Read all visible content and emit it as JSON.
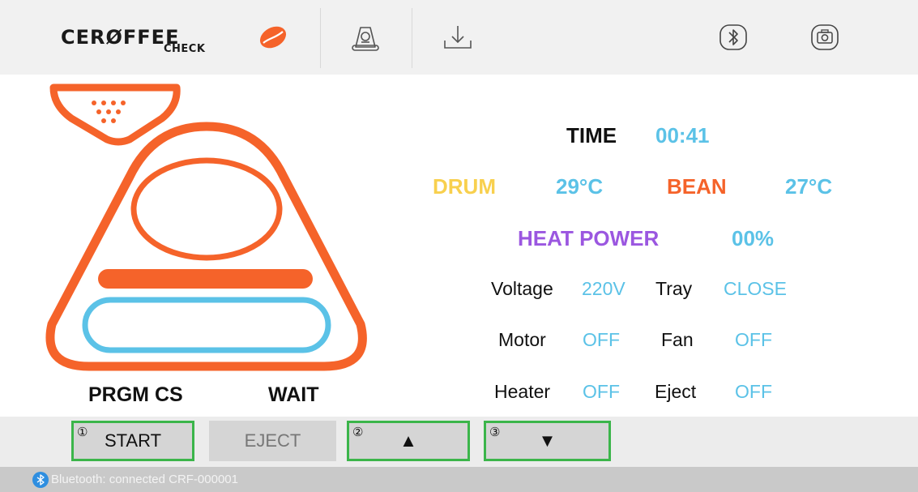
{
  "header": {
    "logo_main": "CERØFFEE",
    "logo_sub": "CHECK",
    "icons": [
      "coffee-bean-icon",
      "roast-profile-icon",
      "download-icon",
      "bluetooth-icon",
      "camera-icon"
    ]
  },
  "machine": {
    "program": "PRGM CS",
    "state": "WAIT"
  },
  "readings": {
    "time_label": "TIME",
    "time_value": "00:41",
    "drum_label": "DRUM",
    "drum_value": "29°C",
    "bean_label": "BEAN",
    "bean_value": "27°C",
    "heat_label": "HEAT POWER",
    "heat_value": "00%",
    "voltage_label": "Voltage",
    "voltage_value": "220V",
    "tray_label": "Tray",
    "tray_value": "CLOSE",
    "motor_label": "Motor",
    "motor_value": "OFF",
    "fan_label": "Fan",
    "fan_value": "OFF",
    "heater_label": "Heater",
    "heater_value": "OFF",
    "eject_label": "Eject",
    "eject_value": "OFF"
  },
  "toolbar": {
    "start_num": "①",
    "start_label": "START",
    "eject_label": "EJECT",
    "up_num": "②",
    "up_label": "▲",
    "down_num": "③",
    "down_label": "▼"
  },
  "status": {
    "text": "Bluetooth: connected  CRF-000001"
  },
  "colors": {
    "orange": "#f5632a",
    "blue": "#5bc2e7",
    "yellow": "#f8d04e",
    "purple": "#9b57e0",
    "green_outline": "#3bb54a",
    "bt_blue": "#2e8ee0"
  }
}
